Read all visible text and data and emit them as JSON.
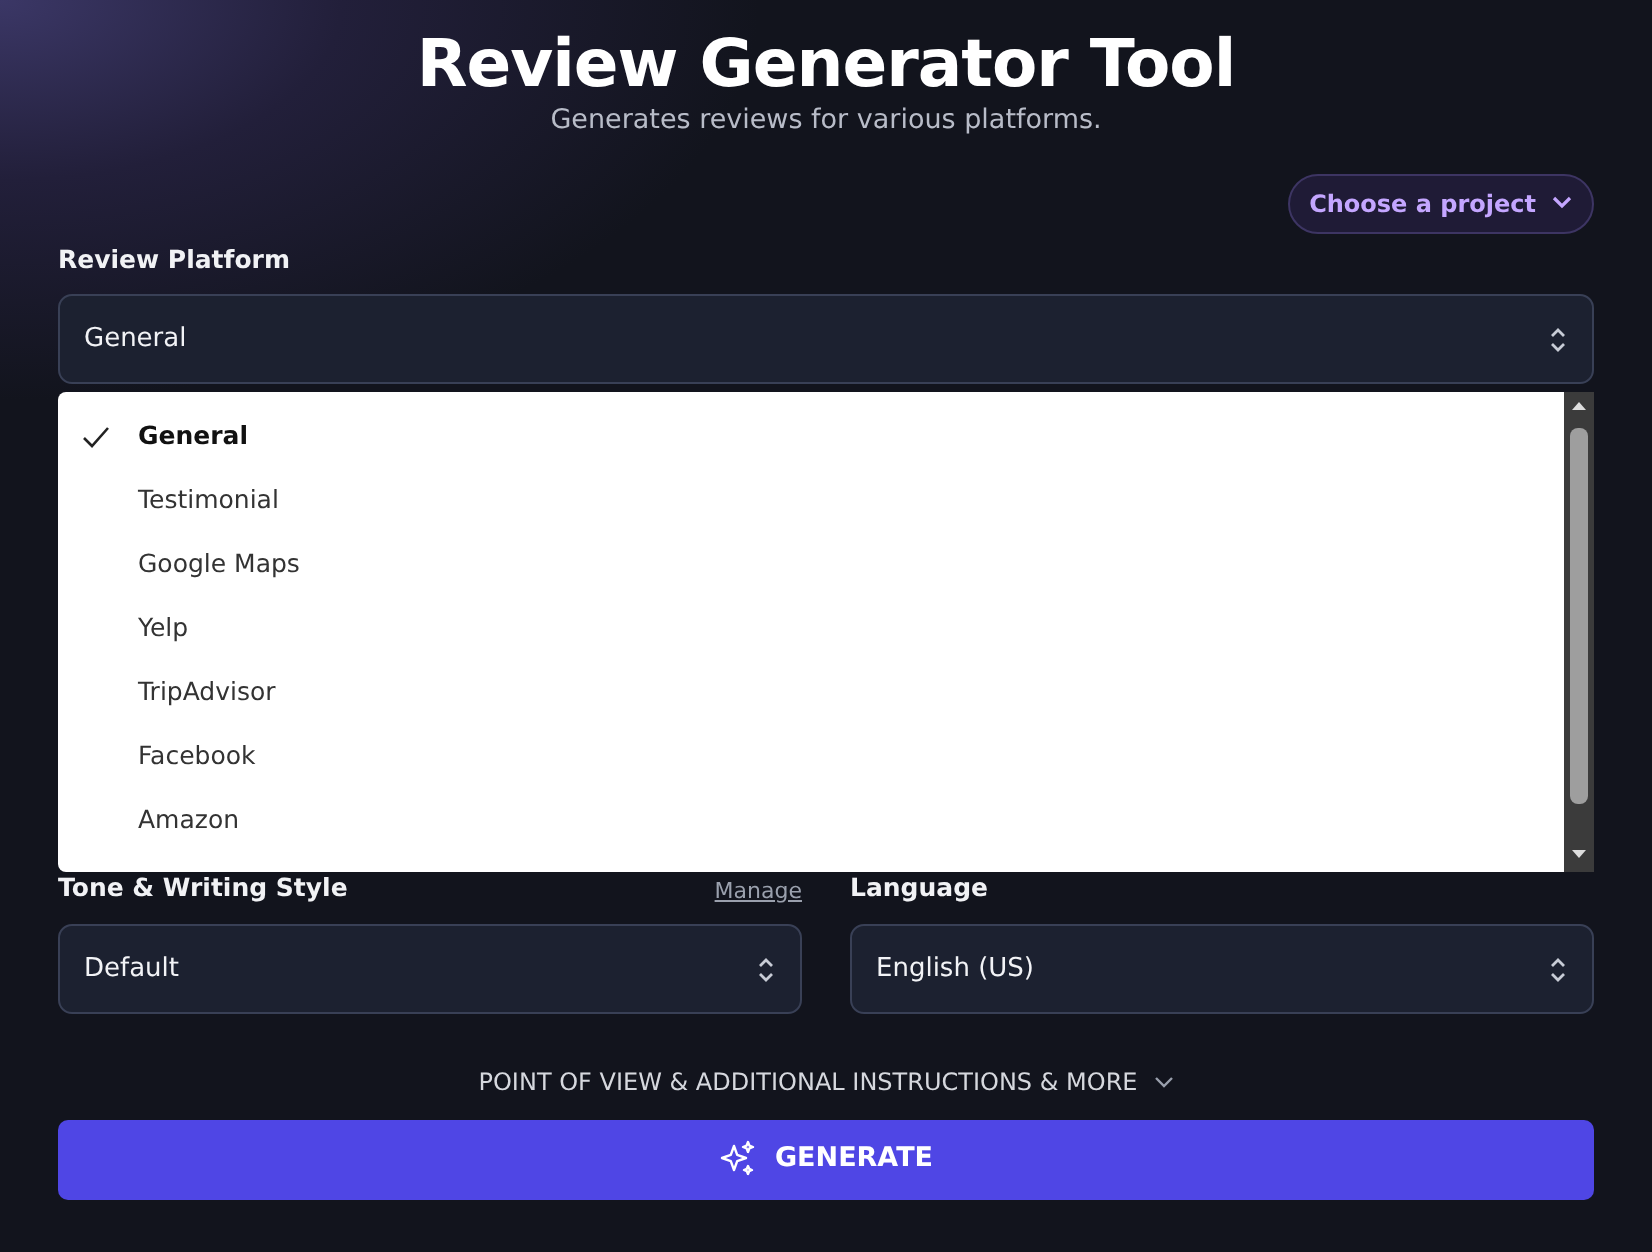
{
  "header": {
    "title": "Review Generator Tool",
    "subtitle": "Generates reviews for various platforms."
  },
  "project_button": {
    "label": "Choose a project"
  },
  "platform": {
    "label": "Review Platform",
    "value": "General",
    "options": [
      {
        "label": "General",
        "selected": true
      },
      {
        "label": "Testimonial",
        "selected": false
      },
      {
        "label": "Google Maps",
        "selected": false
      },
      {
        "label": "Yelp",
        "selected": false
      },
      {
        "label": "TripAdvisor",
        "selected": false
      },
      {
        "label": "Facebook",
        "selected": false
      },
      {
        "label": "Amazon",
        "selected": false
      }
    ]
  },
  "tone": {
    "label": "Tone & Writing Style",
    "manage": "Manage",
    "value": "Default"
  },
  "language": {
    "label": "Language",
    "value": "English (US)"
  },
  "more_toggle": {
    "label": "POINT OF VIEW & ADDITIONAL INSTRUCTIONS & MORE"
  },
  "generate_button": {
    "label": "GENERATE"
  }
}
